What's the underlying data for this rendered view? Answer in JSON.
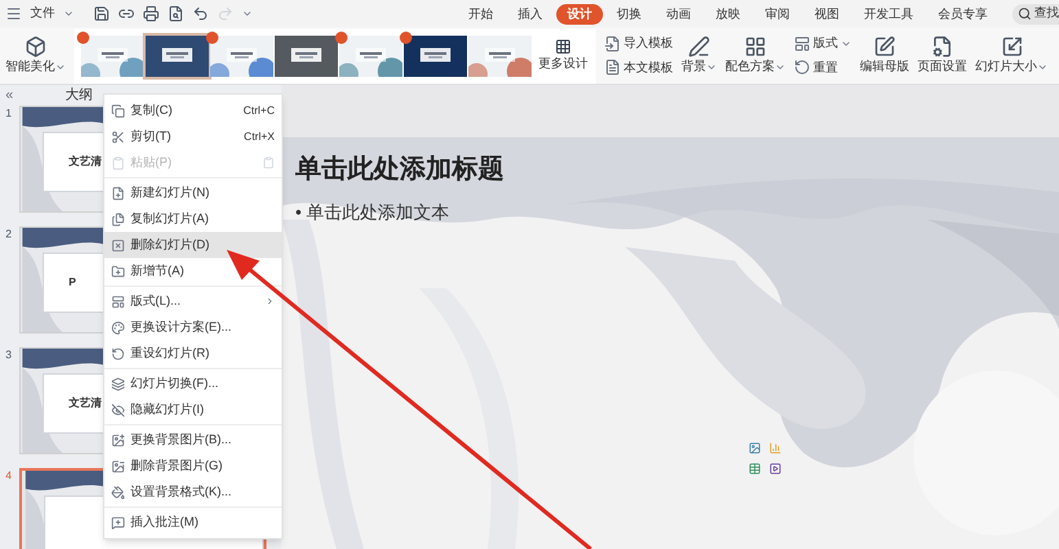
{
  "quick_bar": {
    "file_menu": "文件"
  },
  "tabs": [
    {
      "label": "开始",
      "selected": false
    },
    {
      "label": "插入",
      "selected": false
    },
    {
      "label": "设计",
      "selected": true
    },
    {
      "label": "切换",
      "selected": false
    },
    {
      "label": "动画",
      "selected": false
    },
    {
      "label": "放映",
      "selected": false
    },
    {
      "label": "审阅",
      "selected": false
    },
    {
      "label": "视图",
      "selected": false
    },
    {
      "label": "开发工具",
      "selected": false
    },
    {
      "label": "会员专享",
      "selected": false
    }
  ],
  "search": {
    "label": "查找"
  },
  "ribbon": {
    "smart_beautify": {
      "label": "智能美化",
      "dropdown": true
    },
    "templates": [
      {
        "badge": true,
        "selected": false
      },
      {
        "badge": false,
        "selected": true
      },
      {
        "badge": true,
        "selected": false
      },
      {
        "badge": false,
        "selected": false
      },
      {
        "badge": true,
        "selected": false
      },
      {
        "badge": true,
        "selected": false
      },
      {
        "badge": false,
        "selected": false
      }
    ],
    "more_design": "更多设计",
    "import_template": "导入模板",
    "text_template": "本文模板",
    "tools": [
      {
        "label": "背景",
        "dropdown": true
      },
      {
        "label": "配色方案",
        "dropdown": true
      }
    ],
    "layout": {
      "label": "版式",
      "dropdown": true
    },
    "reset": "重置",
    "tools2": [
      {
        "label": "编辑母版",
        "dropdown": false
      },
      {
        "label": "页面设置",
        "dropdown": false
      },
      {
        "label": "幻灯片大小",
        "dropdown": true
      }
    ]
  },
  "side_panel": {
    "collapse": "«",
    "tab": "大纲",
    "slides": [
      {
        "number": "1",
        "text": "文艺清",
        "selected": false
      },
      {
        "number": "2",
        "text": "P",
        "selected": false
      },
      {
        "number": "3",
        "text": "文艺清",
        "selected": false
      },
      {
        "number": "4",
        "selected": true
      }
    ]
  },
  "slide": {
    "title": "单击此处添加标题",
    "bullet_mark": "•",
    "bullet": "单击此处添加文本"
  },
  "context_menu": [
    {
      "kind": "item",
      "label": "复制(C)",
      "shortcut": "Ctrl+C",
      "disabled": false,
      "selected": false
    },
    {
      "kind": "item",
      "label": "剪切(T)",
      "shortcut": "Ctrl+X",
      "disabled": false,
      "selected": false
    },
    {
      "kind": "item",
      "label": "粘贴(P)",
      "disabled": true,
      "selected": false
    },
    {
      "kind": "divider"
    },
    {
      "kind": "item",
      "label": "新建幻灯片(N)",
      "disabled": false,
      "selected": false
    },
    {
      "kind": "item",
      "label": "复制幻灯片(A)",
      "disabled": false,
      "selected": false
    },
    {
      "kind": "item",
      "label": "删除幻灯片(D)",
      "disabled": false,
      "selected": true
    },
    {
      "kind": "item",
      "label": "新增节(A)",
      "disabled": false,
      "selected": false
    },
    {
      "kind": "divider"
    },
    {
      "kind": "item",
      "label": "版式(L)...",
      "disabled": false,
      "selected": false,
      "submenu": true
    },
    {
      "kind": "item",
      "label": "更换设计方案(E)...",
      "disabled": false,
      "selected": false
    },
    {
      "kind": "item",
      "label": "重设幻灯片(R)",
      "disabled": false,
      "selected": false
    },
    {
      "kind": "divider"
    },
    {
      "kind": "item",
      "label": "幻灯片切换(F)...",
      "disabled": false,
      "selected": false
    },
    {
      "kind": "item",
      "label": "隐藏幻灯片(I)",
      "disabled": false,
      "selected": false
    },
    {
      "kind": "divider"
    },
    {
      "kind": "item",
      "label": "更换背景图片(B)...",
      "disabled": false,
      "selected": false
    },
    {
      "kind": "item",
      "label": "删除背景图片(G)",
      "disabled": false,
      "selected": false
    },
    {
      "kind": "item",
      "label": "设置背景格式(K)...",
      "disabled": false,
      "selected": false
    },
    {
      "kind": "divider"
    },
    {
      "kind": "item",
      "label": "插入批注(M)",
      "disabled": false,
      "selected": false
    }
  ]
}
